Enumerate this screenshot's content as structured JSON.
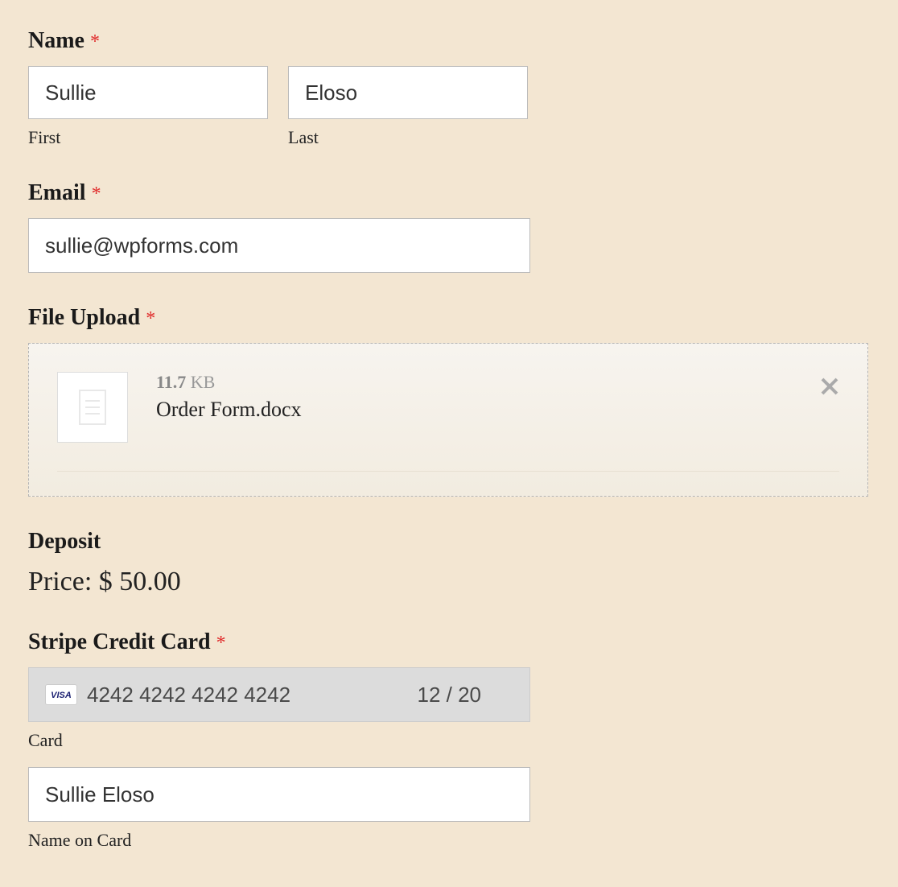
{
  "name": {
    "label": "Name",
    "required": "*",
    "first_value": "Sullie",
    "first_sub": "First",
    "last_value": "Eloso",
    "last_sub": "Last"
  },
  "email": {
    "label": "Email",
    "required": "*",
    "value": "sullie@wpforms.com"
  },
  "upload": {
    "label": "File Upload",
    "required": "*",
    "size_num": "11.7",
    "size_unit": " KB",
    "filename": "Order Form.docx"
  },
  "deposit": {
    "label": "Deposit",
    "price_text": "Price: $ 50.00"
  },
  "stripe": {
    "label": "Stripe Credit Card",
    "required": "*",
    "brand": "VISA",
    "card_number": "4242 4242 4242 4242",
    "expiry": "12 / 20",
    "card_sub": "Card",
    "name_value": "Sullie Eloso",
    "name_sub": "Name on Card"
  }
}
